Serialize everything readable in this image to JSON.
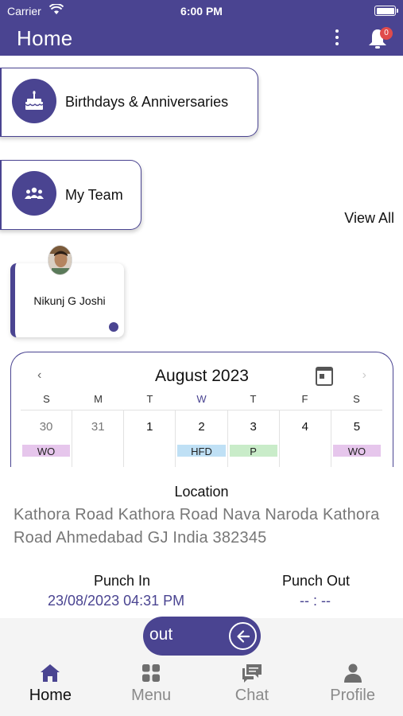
{
  "status_bar": {
    "carrier": "Carrier",
    "time": "6:00 PM"
  },
  "header": {
    "title": "Home",
    "notification_count": "0"
  },
  "cards": {
    "birthdays": {
      "label": "Birthdays & Anniversaries",
      "icon": "cake-icon"
    },
    "team": {
      "label": "My Team",
      "icon": "group-icon"
    }
  },
  "team_section": {
    "view_all": "View All",
    "members": [
      {
        "name": "Nikunj G Joshi"
      }
    ]
  },
  "calendar": {
    "title": "August 2023",
    "weekdays": [
      "S",
      "M",
      "T",
      "W",
      "T",
      "F",
      "S"
    ],
    "days": [
      {
        "num": "30",
        "tag": "WO",
        "tag_color": "#e6c6ec",
        "muted": true
      },
      {
        "num": "31",
        "tag": "",
        "tag_color": "",
        "muted": true
      },
      {
        "num": "1",
        "tag": "",
        "tag_color": "",
        "muted": false
      },
      {
        "num": "2",
        "tag": "HFD",
        "tag_color": "#bfe0f5",
        "muted": false
      },
      {
        "num": "3",
        "tag": "P",
        "tag_color": "#c9ecc9",
        "muted": false
      },
      {
        "num": "4",
        "tag": "",
        "tag_color": "",
        "muted": false
      },
      {
        "num": "5",
        "tag": "WO",
        "tag_color": "#e6c6ec",
        "muted": false
      }
    ]
  },
  "location": {
    "title": "Location",
    "address": "Kathora Road Kathora Road Nava Naroda Kathora Road Ahmedabad GJ India 382345"
  },
  "punch": {
    "in_label": "Punch In",
    "in_value": "23/08/2023 04:31 PM",
    "out_label": "Punch Out",
    "out_value": "-- : --"
  },
  "slider": {
    "label": "out"
  },
  "nav": {
    "tabs": [
      {
        "label": "Home",
        "icon": "home-icon",
        "active": true
      },
      {
        "label": "Menu",
        "icon": "grid-icon",
        "active": false
      },
      {
        "label": "Chat",
        "icon": "chat-icon",
        "active": false
      },
      {
        "label": "Profile",
        "icon": "person-icon",
        "active": false
      }
    ]
  },
  "colors": {
    "primary": "#4a4491",
    "background": "#ffffff",
    "muted_text": "#777777"
  }
}
